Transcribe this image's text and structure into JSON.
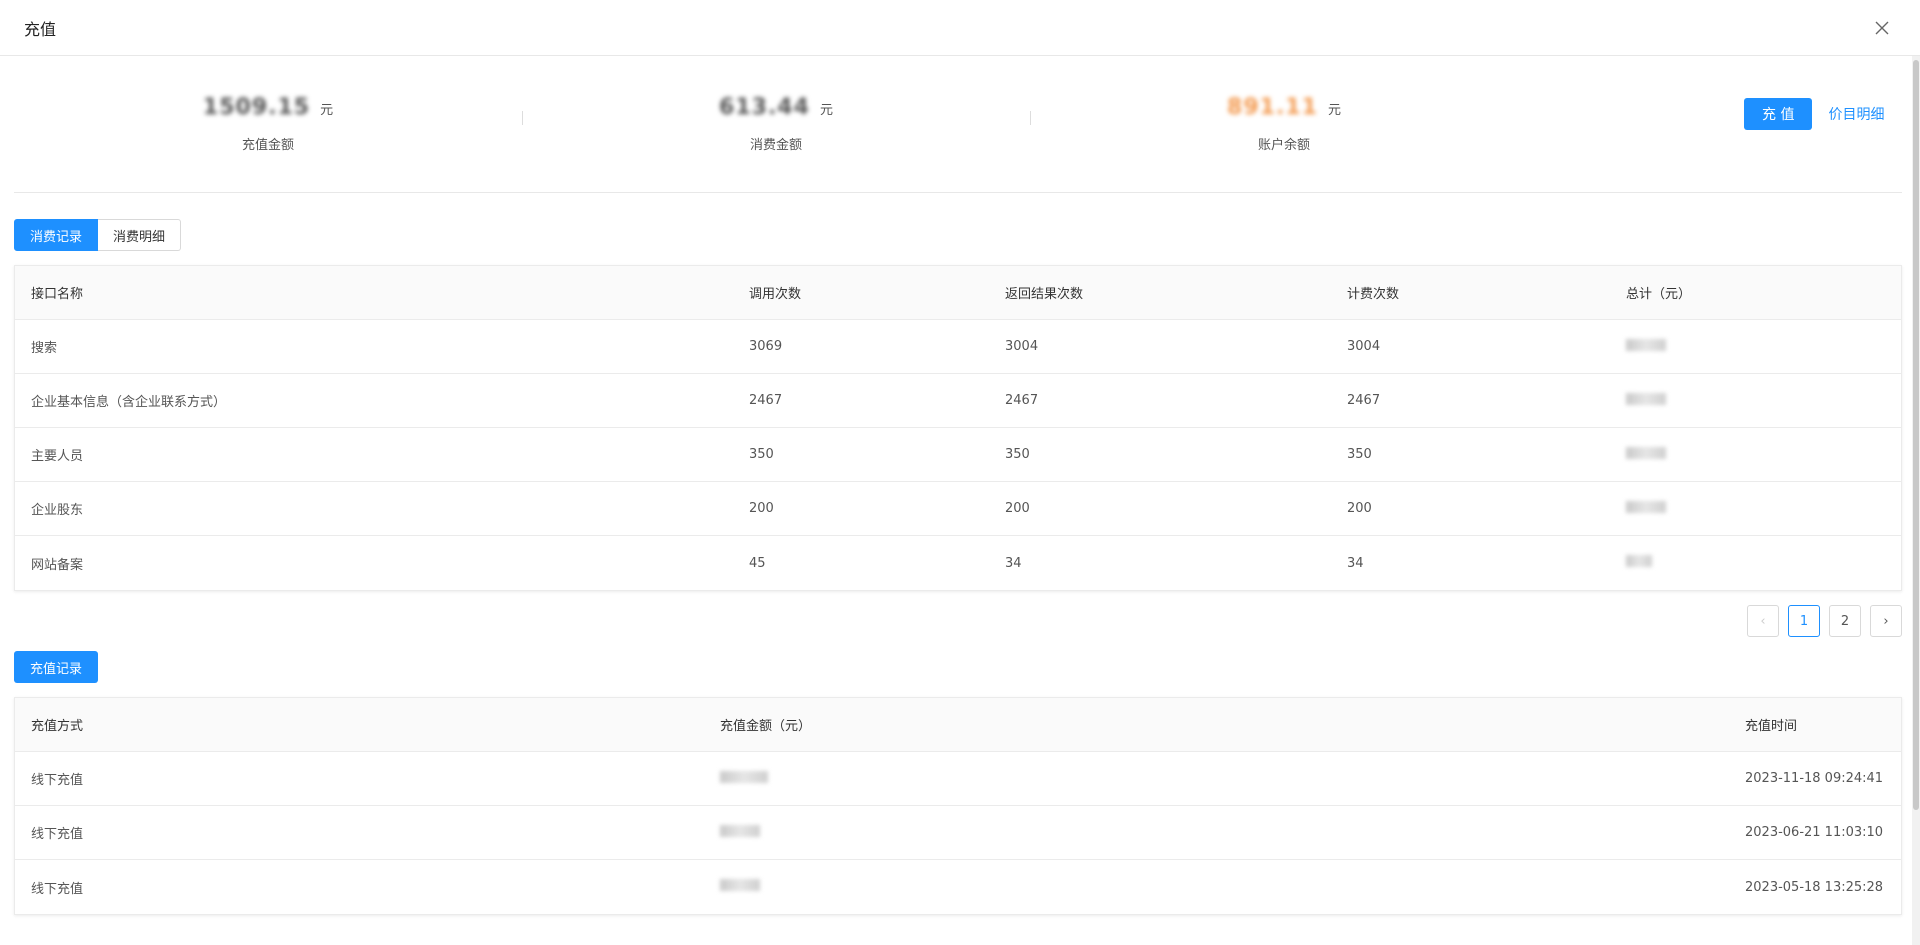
{
  "modal": {
    "title": "充值"
  },
  "summary": {
    "recharge": {
      "value": "1509.15",
      "unit": "元",
      "label": "充值金额"
    },
    "consume": {
      "value": "613.44",
      "unit": "元",
      "label": "消费金额"
    },
    "balance": {
      "value": "891.11",
      "unit": "元",
      "label": "账户余额"
    },
    "recharge_button": "充 值",
    "price_link": "价目明细"
  },
  "tabs": [
    {
      "label": "消费记录",
      "active": true
    },
    {
      "label": "消费明细",
      "active": false
    }
  ],
  "consumption_table": {
    "headers": [
      "接口名称",
      "调用次数",
      "返回结果次数",
      "计费次数",
      "总计（元）"
    ],
    "rows": [
      {
        "name": "搜索",
        "calls": "3069",
        "results": "3004",
        "billed": "3004"
      },
      {
        "name": "企业基本信息（含企业联系方式）",
        "calls": "2467",
        "results": "2467",
        "billed": "2467"
      },
      {
        "name": "主要人员",
        "calls": "350",
        "results": "350",
        "billed": "350"
      },
      {
        "name": "企业股东",
        "calls": "200",
        "results": "200",
        "billed": "200"
      },
      {
        "name": "网站备案",
        "calls": "45",
        "results": "34",
        "billed": "34"
      }
    ]
  },
  "pagination": {
    "prev": "‹",
    "pages": [
      "1",
      "2"
    ],
    "next": "›",
    "current": 1
  },
  "recharge_section": {
    "button": "充值记录",
    "headers": [
      "充值方式",
      "充值金额（元）",
      "充值时间"
    ],
    "rows": [
      {
        "method": "线下充值",
        "time": "2023-11-18 09:24:41"
      },
      {
        "method": "线下充值",
        "time": "2023-06-21 11:03:10"
      },
      {
        "method": "线下充值",
        "time": "2023-05-18 13:25:28"
      }
    ]
  },
  "colors": {
    "primary": "#1e90ff",
    "balance": "#f39a50"
  }
}
